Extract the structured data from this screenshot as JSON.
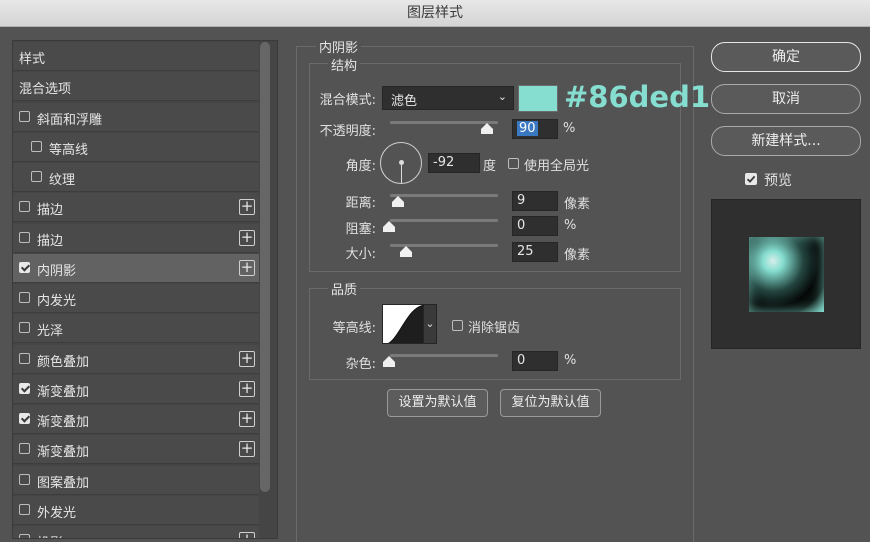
{
  "window": {
    "title": "图层样式"
  },
  "style_list": {
    "items": [
      {
        "label": "样式",
        "checkbox": null,
        "plus": false,
        "selected": false,
        "indent": 0
      },
      {
        "label": "混合选项",
        "checkbox": null,
        "plus": false,
        "selected": false,
        "indent": 0
      },
      {
        "label": "斜面和浮雕",
        "checkbox": false,
        "plus": false,
        "selected": false,
        "indent": 0
      },
      {
        "label": "等高线",
        "checkbox": false,
        "plus": false,
        "selected": false,
        "indent": 1
      },
      {
        "label": "纹理",
        "checkbox": false,
        "plus": false,
        "selected": false,
        "indent": 1
      },
      {
        "label": "描边",
        "checkbox": false,
        "plus": true,
        "selected": false,
        "indent": 0
      },
      {
        "label": "描边",
        "checkbox": false,
        "plus": true,
        "selected": false,
        "indent": 0
      },
      {
        "label": "内阴影",
        "checkbox": true,
        "plus": true,
        "selected": true,
        "indent": 0
      },
      {
        "label": "内发光",
        "checkbox": false,
        "plus": false,
        "selected": false,
        "indent": 0
      },
      {
        "label": "光泽",
        "checkbox": false,
        "plus": false,
        "selected": false,
        "indent": 0
      },
      {
        "label": "颜色叠加",
        "checkbox": false,
        "plus": true,
        "selected": false,
        "indent": 0
      },
      {
        "label": "渐变叠加",
        "checkbox": true,
        "plus": true,
        "selected": false,
        "indent": 0
      },
      {
        "label": "渐变叠加",
        "checkbox": true,
        "plus": true,
        "selected": false,
        "indent": 0
      },
      {
        "label": "渐变叠加",
        "checkbox": false,
        "plus": true,
        "selected": false,
        "indent": 0
      },
      {
        "label": "图案叠加",
        "checkbox": false,
        "plus": false,
        "selected": false,
        "indent": 0
      },
      {
        "label": "外发光",
        "checkbox": false,
        "plus": false,
        "selected": false,
        "indent": 0
      },
      {
        "label": "投影",
        "checkbox": false,
        "plus": true,
        "selected": false,
        "indent": 0
      }
    ]
  },
  "inner_shadow": {
    "section_title": "内阴影",
    "structure": {
      "title": "结构",
      "blend_mode_label": "混合模式:",
      "blend_mode_value": "滤色",
      "color": "#86ded1",
      "color_hex_label": "#86ded1",
      "opacity_label": "不透明度:",
      "opacity_value": "90",
      "opacity_unit": "%",
      "opacity_fraction": 0.9,
      "angle_label": "角度:",
      "angle_value": "-92",
      "angle_unit": "度",
      "global_light_label": "使用全局光",
      "global_light_checked": false,
      "distance_label": "距离:",
      "distance_value": "9",
      "distance_unit": "像素",
      "choke_label": "阻塞:",
      "choke_value": "0",
      "choke_unit": "%",
      "size_label": "大小:",
      "size_value": "25",
      "size_unit": "像素"
    },
    "quality": {
      "title": "品质",
      "contour_label": "等高线:",
      "anti_alias_label": "消除锯齿",
      "anti_alias_checked": false,
      "noise_label": "杂色:",
      "noise_value": "0",
      "noise_unit": "%"
    },
    "buttons": {
      "set_default": "设置为默认值",
      "reset_default": "复位为默认值"
    }
  },
  "right_panel": {
    "ok": "确定",
    "cancel": "取消",
    "new_style": "新建样式...",
    "preview_label": "预览",
    "preview_checked": true
  }
}
